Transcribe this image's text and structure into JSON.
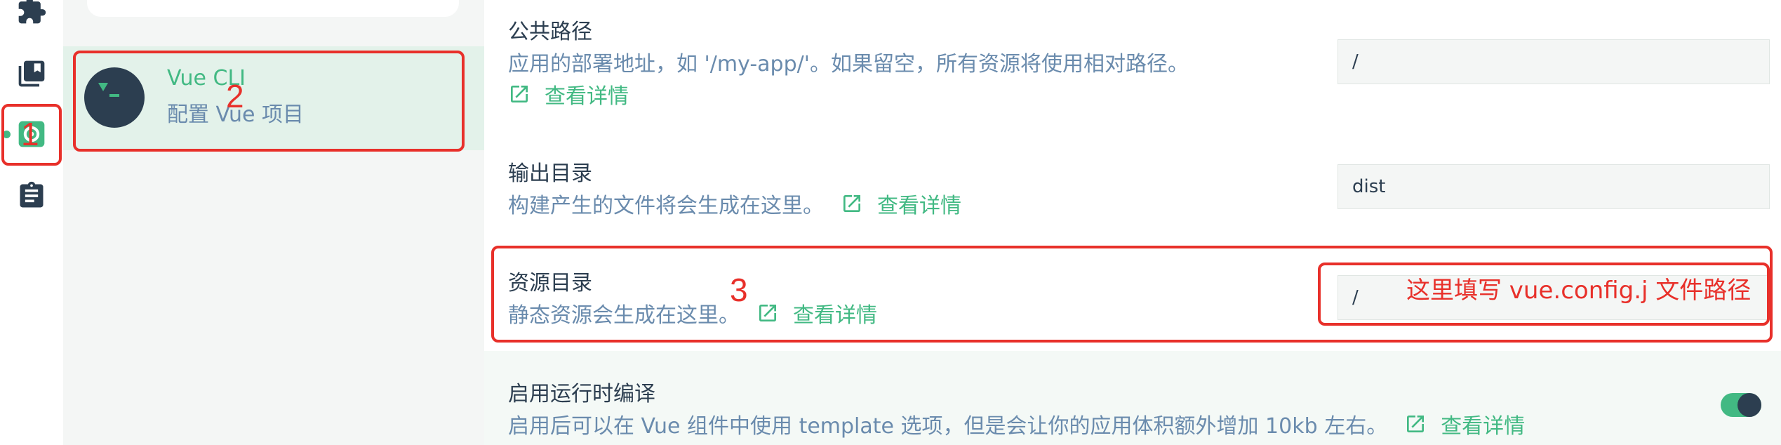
{
  "plugin": {
    "name": "Vue CLI",
    "description": "配置 Vue 项目"
  },
  "settings": [
    {
      "title": "公共路径",
      "description": "应用的部署地址，如 '/my-app/'。如果留空，所有资源将使用相对路径。",
      "link": "查看详情",
      "value": "/"
    },
    {
      "title": "输出目录",
      "description": "构建产生的文件将会生成在这里。",
      "link": "查看详情",
      "value": "dist"
    },
    {
      "title": "资源目录",
      "description": "静态资源会生成在这里。",
      "link": "查看详情",
      "value": "/"
    },
    {
      "title": "启用运行时编译",
      "description": "启用后可以在 Vue 组件中使用 template 选项，但是会让你的应用体积额外增加 10kb 左右。",
      "link": "查看详情",
      "toggle_on": true
    }
  ],
  "annotations": {
    "one": "1",
    "two": "2",
    "three": "3",
    "note": "这里填写 vue.config.j 文件路径"
  },
  "colors": {
    "accent": "#42b983",
    "dark": "#2c3e50",
    "muted": "#6a8bad",
    "annotation": "#e8302a"
  },
  "icons": [
    "puzzle-icon",
    "library-icon",
    "config-icon",
    "clipboard-icon",
    "search-icon",
    "external-link-icon",
    "terminal-icon"
  ]
}
